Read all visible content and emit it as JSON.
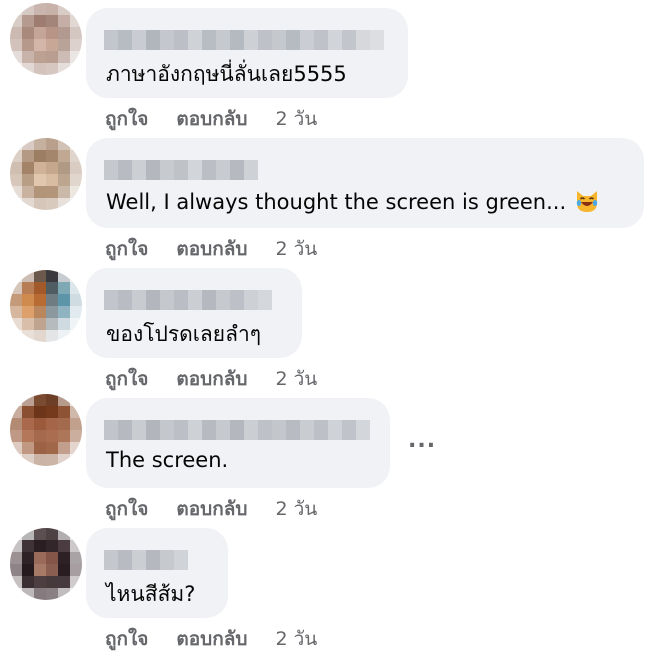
{
  "comments": [
    {
      "text": "ภาษาอังกฤษนี่ลั่นเลย5555",
      "like": "ถูกใจ",
      "reply": "ตอบกลับ",
      "time": "2 วัน"
    },
    {
      "text": "Well, I always thought the screen is green...",
      "like": "ถูกใจ",
      "reply": "ตอบกลับ",
      "time": "2 วัน",
      "emoji": "laughing-cat-face-with-tears-of-joy"
    },
    {
      "text": "ของโปรดเลยลำๆ",
      "like": "ถูกใจ",
      "reply": "ตอบกลับ",
      "time": "2 วัน"
    },
    {
      "text": "The screen.",
      "like": "ถูกใจ",
      "reply": "ตอบกลับ",
      "time": "2 วัน",
      "more": "..."
    },
    {
      "text": "ไหนสีส้ม?",
      "like": "ถูกใจ",
      "reply": "ตอบกลับ",
      "time": "2 วัน"
    }
  ],
  "colors": {
    "bubble": "#f0f2f5",
    "text": "#050505",
    "secondary": "#65676b"
  }
}
